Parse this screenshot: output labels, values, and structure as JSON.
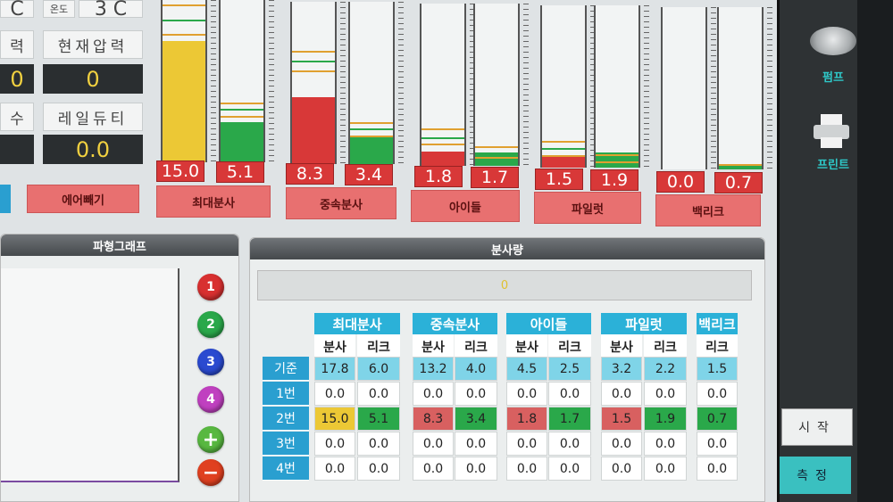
{
  "info": {
    "temp_unit_left": "C",
    "temp_label": "온도",
    "temp_value": "3 C",
    "pressure_label_partial": "력",
    "pressure_label": "현재압력",
    "pressure_left_value": "0",
    "pressure_value": "0",
    "duty_label_partial": "수",
    "duty_label": "레일듀티",
    "duty_value": "0.0",
    "air_vent_button": "에어빼기"
  },
  "gauges": [
    {
      "value": "15.0",
      "level": 0.75,
      "color": "#ecc835"
    },
    {
      "value": "5.1",
      "level": 0.25,
      "color": "#2aa84a"
    },
    {
      "value": "8.3",
      "level": 0.41,
      "color": "#d83838"
    },
    {
      "value": "3.4",
      "level": 0.17,
      "color": "#2aa84a"
    },
    {
      "value": "1.8",
      "level": 0.09,
      "color": "#d83838"
    },
    {
      "value": "1.7",
      "level": 0.085,
      "color": "#2aa84a"
    },
    {
      "value": "1.5",
      "level": 0.075,
      "color": "#d83838"
    },
    {
      "value": "1.9",
      "level": 0.095,
      "color": "#2aa84a"
    },
    {
      "value": "0.0",
      "level": 0.0,
      "color": "#d83838"
    },
    {
      "value": "0.7",
      "level": 0.035,
      "color": "#2aa84a"
    }
  ],
  "gauge_groups": [
    "최대분사",
    "중속분사",
    "아이들",
    "파일럿",
    "백리크"
  ],
  "waveform": {
    "title": "파형그래프",
    "buttons": [
      "1",
      "2",
      "3",
      "4"
    ]
  },
  "dispersion": {
    "title": "분사량",
    "display_value": "0",
    "groups": [
      "최대분사",
      "중속분사",
      "아이들",
      "파일럿",
      "백리크"
    ],
    "sub_headers": [
      "분사",
      "리크",
      "분사",
      "리크",
      "분사",
      "리크",
      "분사",
      "리크",
      "리크"
    ],
    "row_labels": [
      "기준",
      "1번",
      "2번",
      "3번",
      "4번"
    ],
    "rows": [
      [
        "17.8",
        "6.0",
        "13.2",
        "4.0",
        "4.5",
        "2.5",
        "3.2",
        "2.2",
        "1.5"
      ],
      [
        "0.0",
        "0.0",
        "0.0",
        "0.0",
        "0.0",
        "0.0",
        "0.0",
        "0.0",
        "0.0"
      ],
      [
        "15.0",
        "5.1",
        "8.3",
        "3.4",
        "1.8",
        "1.7",
        "1.5",
        "1.9",
        "0.7"
      ],
      [
        "0.0",
        "0.0",
        "0.0",
        "0.0",
        "0.0",
        "0.0",
        "0.0",
        "0.0",
        "0.0"
      ],
      [
        "0.0",
        "0.0",
        "0.0",
        "0.0",
        "0.0",
        "0.0",
        "0.0",
        "0.0",
        "0.0"
      ]
    ],
    "row2_colors": [
      "#ecc835",
      "#2aa84a",
      "#d86060",
      "#2aa84a",
      "#d86060",
      "#2aa84a",
      "#d86060",
      "#2aa84a",
      "#2aa84a"
    ]
  },
  "side": {
    "pump_label": "펌프",
    "print_label": "프린트",
    "start_button": "시작",
    "measure_button": "측정"
  },
  "colors": {
    "accent": "#2bb1d8",
    "red": "#d83838",
    "green": "#2aa84a",
    "yellow": "#ecc835"
  }
}
